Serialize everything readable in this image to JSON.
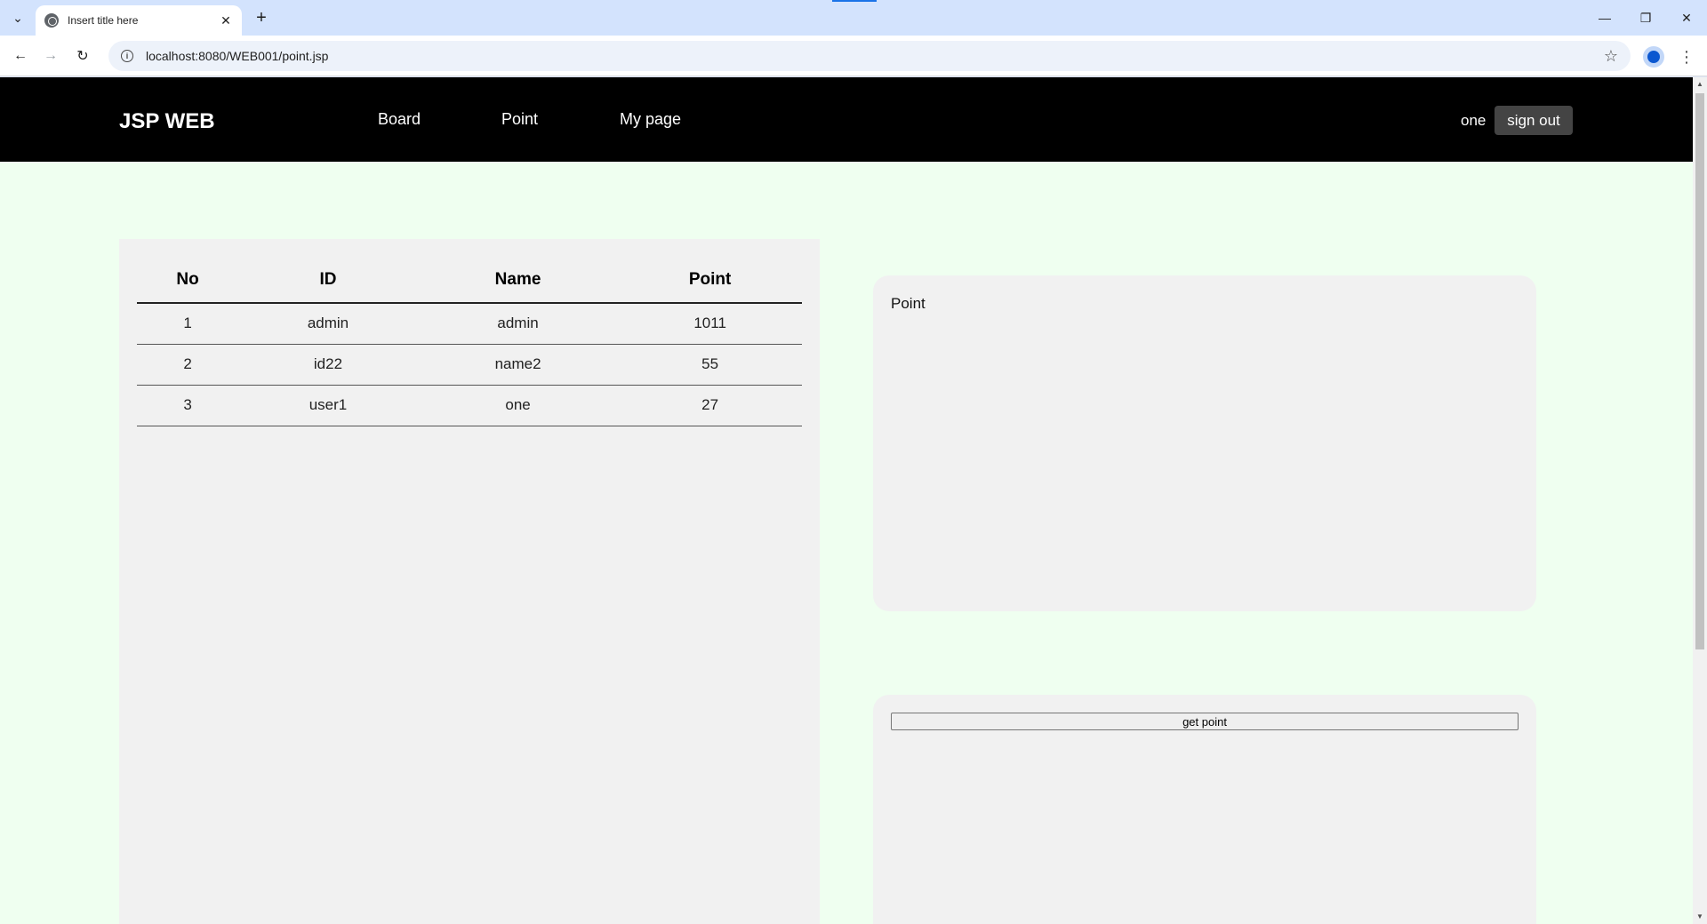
{
  "browser": {
    "tab_title": "Insert title here",
    "tab_close": "✕",
    "new_tab": "+",
    "url": "localhost:8080/WEB001/point.jsp",
    "back": "←",
    "forward": "→",
    "reload": "↻",
    "star": "☆",
    "menu": "⋮",
    "tab_list": "⌄",
    "minimize": "—",
    "restore": "❐",
    "close": "✕"
  },
  "header": {
    "logo": "JSP WEB",
    "nav": [
      "Board",
      "Point",
      "My page"
    ],
    "username": "one",
    "signout_label": "sign out"
  },
  "table": {
    "columns": [
      "No",
      "ID",
      "Name",
      "Point"
    ],
    "rows": [
      [
        "1",
        "admin",
        "admin",
        "1011"
      ],
      [
        "2",
        "id22",
        "name2",
        "55"
      ],
      [
        "3",
        "user1",
        "one",
        "27"
      ]
    ]
  },
  "point_card": {
    "title": "Point"
  },
  "actions": {
    "get_point_label": "get point"
  }
}
